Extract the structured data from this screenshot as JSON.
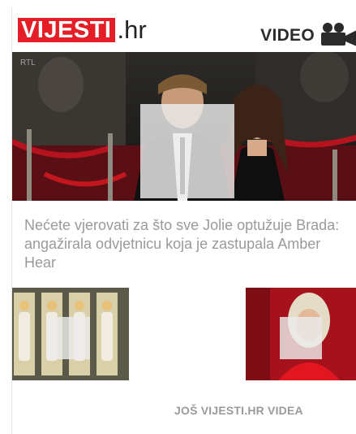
{
  "logo": {
    "brand": "VIJESTI",
    "tld": ".hr"
  },
  "header": {
    "video_label": "VIDEO",
    "icon": "video-camera-icon"
  },
  "hero": {
    "watermark": "RTL",
    "caption": "Nećete vjerovati za što sve Jolie optužuje Brada: angažirala odvjetnicu koja je zastupala Amber Hear"
  },
  "thumbnails": [
    {
      "name": "thumb-fashion-video"
    },
    {
      "name": "thumb-red-carpet-video"
    }
  ],
  "footer": {
    "more_label": "JOŠ VIJESTI.HR VIDEA"
  },
  "colors": {
    "brand_red": "#e41e26",
    "caption_gray": "#9a9a9a"
  }
}
